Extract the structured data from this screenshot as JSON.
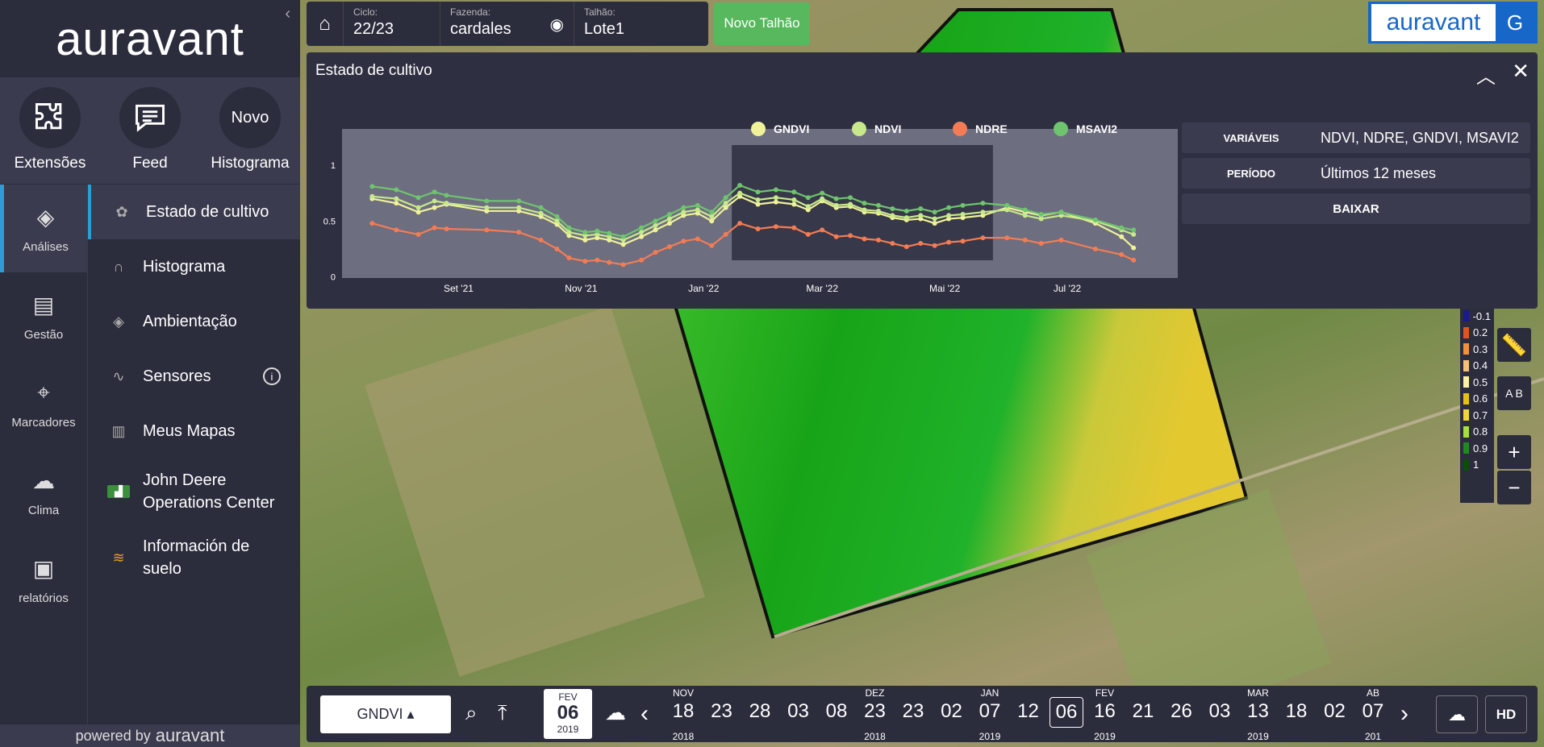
{
  "sidebar": {
    "logo": "auravant",
    "quick_actions": [
      {
        "label": "Extensões",
        "icon": "puzzle-icon"
      },
      {
        "label": "Feed",
        "icon": "chat-icon"
      },
      {
        "label": "Histograma",
        "circle_text": "Novo"
      }
    ],
    "rail": [
      {
        "label": "Análises",
        "icon": "layers-icon"
      },
      {
        "label": "Gestão",
        "icon": "clipboard-icon"
      },
      {
        "label": "Marcadores",
        "icon": "pin-icon"
      },
      {
        "label": "Clima",
        "icon": "cloud-icon"
      },
      {
        "label": "relatórios",
        "icon": "report-icon"
      }
    ],
    "submenu": [
      {
        "label": "Estado de cultivo",
        "icon": "plant-icon"
      },
      {
        "label": "Histograma",
        "icon": "curve-icon"
      },
      {
        "label": "Ambientação",
        "icon": "layers-icon"
      },
      {
        "label": "Sensores",
        "icon": "wave-icon"
      },
      {
        "label": "Meus Mapas",
        "icon": "map-icon"
      },
      {
        "label": "John Deere Operations Center",
        "icon": "tractor-icon"
      },
      {
        "label": "Información de suelo",
        "icon": "soil-icon"
      }
    ],
    "powered_by": "powered by",
    "powered_brand": "auravant"
  },
  "topbar": {
    "ciclo_label": "Ciclo:",
    "ciclo_value": "22/23",
    "fazenda_label": "Fazenda:",
    "fazenda_value": "cardales",
    "talhao_label": "Talhão:",
    "talhao_value": "Lote1",
    "novo_talhao": "Novo Talhão"
  },
  "brand": {
    "logo": "auravant",
    "user_initial": "G"
  },
  "panel": {
    "title": "Estado de cultivo",
    "info": [
      {
        "key": "VARIÁVEIS",
        "value": "NDVI, NDRE, GNDVI, MSAVI2"
      },
      {
        "key": "PERÍODO",
        "value": "Últimos 12 meses"
      }
    ],
    "download": "BAIXAR"
  },
  "chart_data": {
    "type": "line",
    "legend_position": "top",
    "ylim": [
      0,
      1
    ],
    "yticks": [
      "0",
      "0.5",
      "1"
    ],
    "x_ticks": [
      "Set '21",
      "Nov '21",
      "Jan '22",
      "Mar '22",
      "Mai '22",
      "Jul '22"
    ],
    "x": [
      "2021-07-20",
      "2021-08-01",
      "2021-08-12",
      "2021-08-20",
      "2021-08-26",
      "2021-09-15",
      "2021-10-01",
      "2021-10-12",
      "2021-10-20",
      "2021-10-26",
      "2021-11-03",
      "2021-11-09",
      "2021-11-15",
      "2021-11-22",
      "2021-12-01",
      "2021-12-08",
      "2021-12-15",
      "2021-12-22",
      "2021-12-29",
      "2022-01-05",
      "2022-01-12",
      "2022-01-19",
      "2022-01-28",
      "2022-02-06",
      "2022-02-15",
      "2022-02-22",
      "2022-03-01",
      "2022-03-08",
      "2022-03-15",
      "2022-03-22",
      "2022-03-29",
      "2022-04-05",
      "2022-04-12",
      "2022-04-19",
      "2022-04-26",
      "2022-05-03",
      "2022-05-10",
      "2022-05-20",
      "2022-06-01",
      "2022-06-10",
      "2022-06-18",
      "2022-06-28",
      "2022-07-15",
      "2022-07-28",
      "2022-08-03"
    ],
    "series": [
      {
        "name": "GNDVI",
        "color": "#f0f29a",
        "values": [
          0.7,
          0.66,
          0.58,
          0.62,
          0.65,
          0.59,
          0.59,
          0.54,
          0.47,
          0.37,
          0.33,
          0.35,
          0.33,
          0.29,
          0.36,
          0.42,
          0.48,
          0.55,
          0.57,
          0.5,
          0.62,
          0.72,
          0.65,
          0.67,
          0.65,
          0.6,
          0.68,
          0.62,
          0.63,
          0.58,
          0.57,
          0.53,
          0.51,
          0.52,
          0.48,
          0.52,
          0.53,
          0.55,
          0.62,
          0.58,
          0.55,
          0.58,
          0.48,
          0.36,
          0.26
        ]
      },
      {
        "name": "NDVI",
        "color": "#c8e88c",
        "values": [
          0.72,
          0.7,
          0.62,
          0.68,
          0.66,
          0.62,
          0.62,
          0.57,
          0.5,
          0.4,
          0.37,
          0.38,
          0.36,
          0.33,
          0.4,
          0.46,
          0.52,
          0.58,
          0.6,
          0.54,
          0.66,
          0.75,
          0.69,
          0.71,
          0.69,
          0.63,
          0.7,
          0.64,
          0.65,
          0.6,
          0.59,
          0.55,
          0.53,
          0.55,
          0.52,
          0.55,
          0.56,
          0.58,
          0.6,
          0.55,
          0.52,
          0.55,
          0.5,
          0.42,
          0.38
        ]
      },
      {
        "name": "NDRE",
        "color": "#f47c54",
        "values": [
          0.48,
          0.42,
          0.38,
          0.44,
          0.43,
          0.42,
          0.4,
          0.33,
          0.25,
          0.17,
          0.14,
          0.15,
          0.13,
          0.11,
          0.15,
          0.22,
          0.27,
          0.32,
          0.34,
          0.28,
          0.38,
          0.48,
          0.43,
          0.45,
          0.44,
          0.38,
          0.42,
          0.36,
          0.37,
          0.34,
          0.33,
          0.3,
          0.27,
          0.3,
          0.28,
          0.31,
          0.32,
          0.35,
          0.35,
          0.33,
          0.3,
          0.33,
          0.25,
          0.2,
          0.15
        ]
      },
      {
        "name": "MSAVI2",
        "color": "#6fc46e",
        "values": [
          0.81,
          0.78,
          0.71,
          0.76,
          0.73,
          0.68,
          0.68,
          0.62,
          0.54,
          0.44,
          0.4,
          0.41,
          0.39,
          0.36,
          0.44,
          0.5,
          0.56,
          0.62,
          0.64,
          0.58,
          0.71,
          0.82,
          0.76,
          0.78,
          0.76,
          0.71,
          0.75,
          0.7,
          0.71,
          0.66,
          0.64,
          0.61,
          0.59,
          0.61,
          0.58,
          0.62,
          0.64,
          0.66,
          0.64,
          0.6,
          0.56,
          0.58,
          0.51,
          0.44,
          0.42
        ]
      }
    ]
  },
  "map_legend": [
    {
      "label": "-0.1",
      "color": "#1a1a8a"
    },
    {
      "label": "0.2",
      "color": "#e2541e"
    },
    {
      "label": "0.3",
      "color": "#f2913a"
    },
    {
      "label": "0.4",
      "color": "#f6c07a"
    },
    {
      "label": "0.5",
      "color": "#fbf0a6"
    },
    {
      "label": "0.6",
      "color": "#e6c010"
    },
    {
      "label": "0.7",
      "color": "#f0d43a"
    },
    {
      "label": "0.8",
      "color": "#a6e03c"
    },
    {
      "label": "0.9",
      "color": "#1f8a1f"
    },
    {
      "label": "1",
      "color": "#0c4d0c"
    }
  ],
  "map_tools": {
    "zoom_in": "+",
    "zoom_out": "−",
    "ab": "A B"
  },
  "bottombar": {
    "layer": "GNDVI ▴",
    "date_month": "FEV",
    "date_day": "06",
    "date_year": "2019",
    "timeline": {
      "days": [
        "18",
        "23",
        "28",
        "03",
        "08",
        "23",
        "23",
        "02",
        "07",
        "12",
        "06",
        "16",
        "21",
        "26",
        "03",
        "13",
        "18",
        "02",
        "07"
      ],
      "selected_index": 10,
      "months": [
        {
          "label": "NOV",
          "index": 0
        },
        {
          "label": "DEZ",
          "index": 5
        },
        {
          "label": "JAN",
          "index": 8
        },
        {
          "label": "FEV",
          "index": 11
        },
        {
          "label": "MAR",
          "index": 15
        },
        {
          "label": "AB",
          "index": 18
        }
      ],
      "years": [
        {
          "label": "2018",
          "index": 0
        },
        {
          "label": "2018",
          "index": 5
        },
        {
          "label": "2019",
          "index": 8
        },
        {
          "label": "2019",
          "index": 11
        },
        {
          "label": "2019",
          "index": 15
        },
        {
          "label": "201",
          "index": 18
        }
      ]
    },
    "hd": "HD"
  }
}
